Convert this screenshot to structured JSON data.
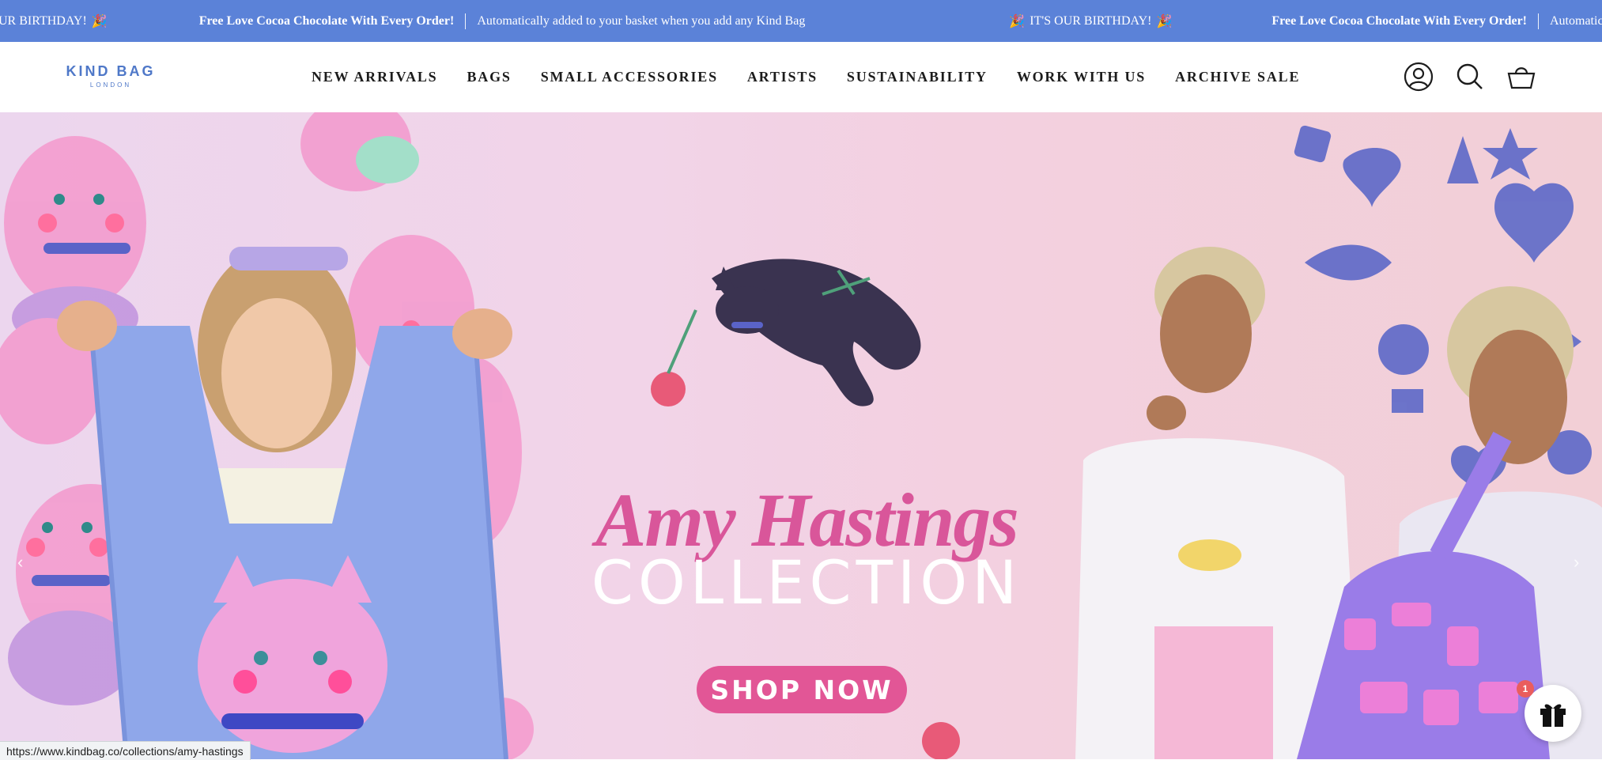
{
  "announcement": {
    "birthday_partial": "UR BIRTHDAY!",
    "birthday_full": "IT'S OUR BIRTHDAY!",
    "offer": "Free Love Cocoa Chocolate With Every Order!",
    "detail": "Automatically added to your basket when you add any Kind Bag",
    "detail_partial": "Automatic",
    "party_icon": "party-popper-icon"
  },
  "header": {
    "logo": {
      "brand": "KIND BAG",
      "sub": "LONDON"
    },
    "nav": [
      {
        "label": "NEW ARRIVALS"
      },
      {
        "label": "BAGS"
      },
      {
        "label": "SMALL ACCESSORIES"
      },
      {
        "label": "ARTISTS"
      },
      {
        "label": "SUSTAINABILITY"
      },
      {
        "label": "WORK WITH US"
      },
      {
        "label": "ARCHIVE SALE"
      }
    ],
    "icons": [
      "account-icon",
      "search-icon",
      "basket-icon"
    ]
  },
  "hero": {
    "title_script": "Amy Hastings",
    "title_collection": "COLLECTION",
    "cta": "SHOP NOW",
    "prev": "‹",
    "next": "›"
  },
  "gift_widget": {
    "badge": "1"
  },
  "status_url": "https://www.kindbag.co/collections/amy-hastings",
  "colors": {
    "announcement_bg": "#5b82d8",
    "logo": "#4f78c8",
    "cta_bg": "#e25696",
    "script": "#d9569a"
  }
}
